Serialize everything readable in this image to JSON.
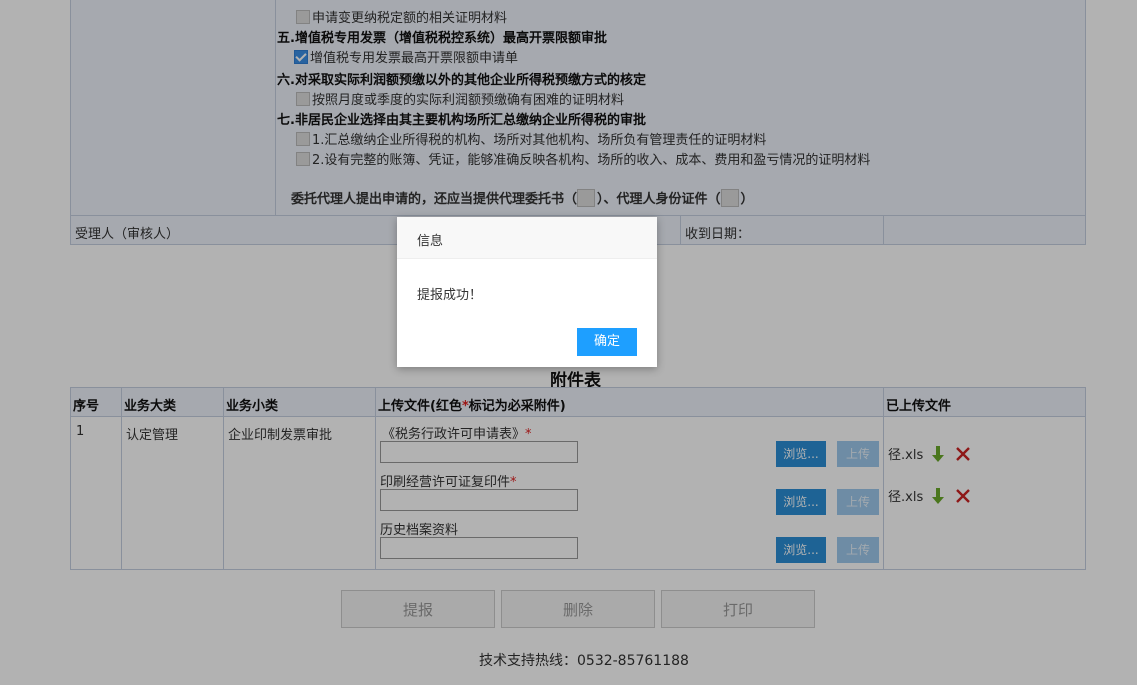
{
  "form": {
    "sec4_item": "申请变更纳税定额的相关证明材料",
    "sec5_heading": "五.增值税专用发票（增值税税控系统）最高开票限额审批",
    "sec5_item": "增值税专用发票最高开票限额申请单",
    "sec6_heading": "六.对采取实际利润额预缴以外的其他企业所得税预缴方式的核定",
    "sec6_item": "按照月度或季度的实际利润额预缴确有困难的证明材料",
    "sec7_heading": "七.非居民企业选择由其主要机构场所汇总缴纳企业所得税的审批",
    "sec7_item1": "1.汇总缴纳企业所得税的机构、场所对其他机构、场所负有管理责任的证明材料",
    "sec7_item2": "2.设有完整的账簿、凭证，能够准确反映各机构、场所的收入、成本、费用和盈亏情况的证明材料",
    "proxy_text_a": "委托代理人提出申请的，还应当提供代理委托书（",
    "proxy_text_b": "）、代理人身份证件（",
    "proxy_text_c": "）",
    "receiver_label": "受理人（审核人）",
    "received_date_label": "收到日期："
  },
  "attachments": {
    "title": "附件表",
    "headers": {
      "seq": "序号",
      "category": "业务大类",
      "subcategory": "业务小类",
      "upload": "上传文件(红色",
      "upload_star": "*",
      "upload_suffix": "标记为必采附件)",
      "uploaded": "已上传文件"
    },
    "row": {
      "seq": "1",
      "category": "认定管理",
      "subcategory": "企业印制发票审批"
    },
    "files": [
      {
        "label": "《税务行政许可申请表》",
        "required": "*"
      },
      {
        "label": "印刷经营许可证复印件",
        "required": "*"
      },
      {
        "label": "历史档案资料",
        "required": ""
      }
    ],
    "browse_label": "浏览...",
    "upload_label": "上传",
    "uploaded_files": [
      "径.xls",
      "径.xls"
    ]
  },
  "actions": {
    "submit": "提报",
    "delete": "删除",
    "print": "打印"
  },
  "footer": {
    "hotline": "技术支持热线：0532-85761188"
  },
  "dialog": {
    "title": "信息",
    "message": "提报成功！",
    "ok": "确定"
  },
  "colors": {
    "accent": "#1e9fff",
    "browse": "#2c8fd6",
    "delete_icon": "#cc2222",
    "download_icon": "#6aaa2a"
  }
}
